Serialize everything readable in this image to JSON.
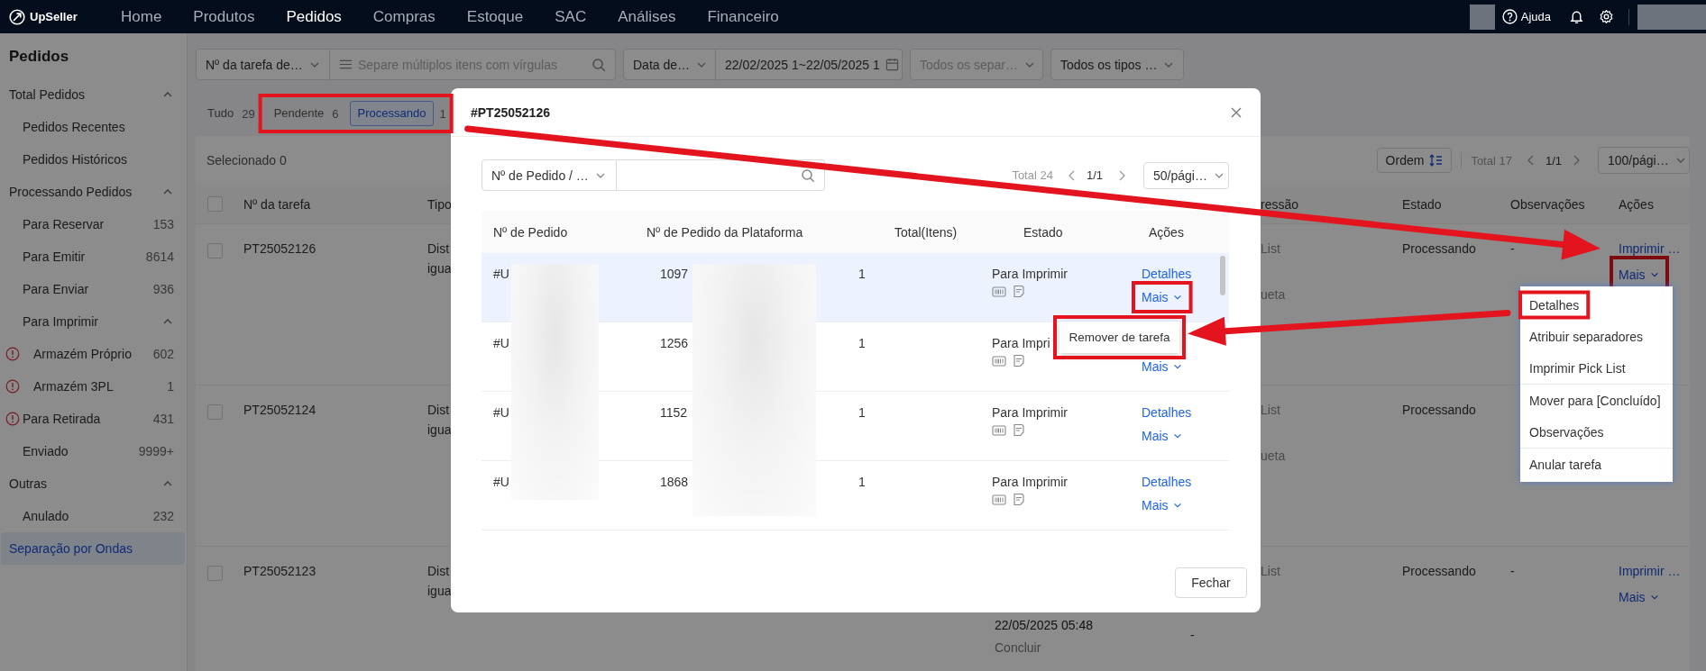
{
  "top_nav": {
    "logo": "UpSeller",
    "items": [
      {
        "label": "Home",
        "selected": false
      },
      {
        "label": "Produtos",
        "selected": false
      },
      {
        "label": "Pedidos",
        "selected": true
      },
      {
        "label": "Compras",
        "selected": false
      },
      {
        "label": "Estoque",
        "selected": false
      },
      {
        "label": "SAC",
        "selected": false
      },
      {
        "label": "Análises",
        "selected": false
      },
      {
        "label": "Financeiro",
        "selected": false
      }
    ],
    "help": "Ajuda"
  },
  "sidebar": {
    "title": "Pedidos",
    "items": [
      {
        "label": "Total Pedidos",
        "expanded": true,
        "selected": false,
        "warning": false,
        "children": [
          {
            "label": "Pedidos Recentes",
            "selected": false,
            "warning": false
          },
          {
            "label": "Pedidos Históricos",
            "selected": false,
            "warning": false
          }
        ]
      },
      {
        "label": "Processando Pedidos",
        "expanded": true,
        "selected": false,
        "warning": false,
        "children": [
          {
            "label": "Para Reservar",
            "count": "153",
            "selected": false,
            "warning": false
          },
          {
            "label": "Para Emitir",
            "count": "8614",
            "selected": false,
            "warning": false
          },
          {
            "label": "Para Enviar",
            "count": "936",
            "selected": false,
            "warning": false
          },
          {
            "label": "Para Imprimir",
            "expanded": true,
            "selected": false,
            "warning": false,
            "children": [
              {
                "label": "Armazém Próprio",
                "count": "602",
                "selected": false,
                "warning": true
              },
              {
                "label": "Armazém 3PL",
                "count": "1",
                "selected": false,
                "warning": true
              }
            ]
          },
          {
            "label": "Para Retirada",
            "count": "431",
            "selected": false,
            "warning": true
          },
          {
            "label": "Enviado",
            "count": "9999+",
            "selected": false,
            "warning": false
          }
        ]
      },
      {
        "label": "Outras",
        "expanded": true,
        "selected": false,
        "warning": false,
        "children": [
          {
            "label": "Anulado",
            "count": "232",
            "selected": false,
            "warning": false
          }
        ]
      },
      {
        "label": "Separação por Ondas",
        "selected": true,
        "warning": false
      }
    ]
  },
  "filters": [
    {
      "kind": "select",
      "value": "Nº da tarefa de…",
      "attached": true
    },
    {
      "kind": "search",
      "placeholder": "Separe múltiplos itens com vírgulas",
      "attached": false
    },
    {
      "kind": "select",
      "value": "Data de…",
      "attached": true
    },
    {
      "kind": "date",
      "value": "22/02/2025 1~22/05/2025 1",
      "attached": false
    },
    {
      "kind": "select",
      "placeholder": "Todos os separ…",
      "attached": false
    },
    {
      "kind": "select",
      "value": "Todos os tipos …",
      "attached": false
    }
  ],
  "status_tabs": [
    {
      "label": "Tudo",
      "count": "29",
      "selected": false,
      "highlighted": false
    },
    {
      "label": "Pendente",
      "count": "6",
      "selected": false,
      "highlighted": true
    },
    {
      "label": "Processando",
      "count": "1",
      "selected": true,
      "highlighted": true
    }
  ],
  "task_table": {
    "toolbar": {
      "selection": "Selecionado 0",
      "sort_button": "Ordem",
      "total": "Total 17",
      "page": "1/1",
      "page_size": "100/pági…"
    },
    "header_checked": false,
    "columns": [
      "Nº da tarefa",
      "Tipo",
      "ressão",
      "Estado",
      "Observações",
      "Ações"
    ],
    "rows": [
      {
        "checked": false,
        "task": "PT25052126",
        "type_lines": [
          "Dist",
          "igua"
        ],
        "print_lines": [
          "List",
          "ueta"
        ],
        "status": "Processando",
        "notes": "-",
        "actions": [
          {
            "kind": "link",
            "label": "Imprimir …",
            "highlighted": false
          },
          {
            "kind": "menu",
            "label": "Mais",
            "highlighted": true
          }
        ]
      },
      {
        "checked": false,
        "task": "PT25052124",
        "type_lines": [
          "Dist",
          "igua"
        ],
        "print_lines": [
          "List",
          "ueta"
        ],
        "status": "Processando"
      },
      {
        "checked": false,
        "task": "PT25052123",
        "type_lines": [
          "Dist",
          "igua"
        ],
        "schedule_lines": [
          "22/05/2025 05:48",
          "Concluir"
        ],
        "print_extra": "-",
        "print_lines": [
          "List"
        ],
        "status": "Processando",
        "notes": "-",
        "actions": [
          {
            "kind": "link",
            "label": "Imprimir …",
            "highlighted": false
          },
          {
            "kind": "menu",
            "label": "Mais",
            "highlighted": false
          }
        ]
      }
    ]
  },
  "modal": {
    "title": "#PT25052126",
    "filter_select": "Nº de Pedido / …",
    "total": "Total 24",
    "page": "1/1",
    "page_size": "50/pági…",
    "columns": [
      "Nº de Pedido",
      "Nº de Pedido da Plataforma",
      "Total(Itens)",
      "Estado",
      "Ações"
    ],
    "rows": [
      {
        "order": "#U",
        "platform": "1097",
        "total": "1",
        "status": "Para Imprimir",
        "hover": true,
        "actions": [
          {
            "kind": "link",
            "label": "Detalhes",
            "highlighted": false
          },
          {
            "kind": "menu",
            "label": "Mais",
            "highlighted": true
          }
        ]
      },
      {
        "order": "#U",
        "platform": "1256",
        "total": "1",
        "status": "Para Impri",
        "hover": false,
        "actions": [
          {
            "kind": "menu",
            "label": "Mais",
            "highlighted": false
          }
        ]
      },
      {
        "order": "#U",
        "platform": "1152",
        "total": "1",
        "status": "Para Imprimir",
        "hover": false,
        "actions": [
          {
            "kind": "link",
            "label": "Detalhes",
            "highlighted": false
          },
          {
            "kind": "menu",
            "label": "Mais",
            "highlighted": false
          }
        ]
      },
      {
        "order": "#U",
        "platform": "1868",
        "total": "1",
        "status": "Para Imprimir",
        "hover": false,
        "actions": [
          {
            "kind": "link",
            "label": "Detalhes",
            "highlighted": false
          },
          {
            "kind": "menu",
            "label": "Mais",
            "highlighted": false
          }
        ]
      }
    ],
    "close_button": "Fechar"
  },
  "row_menu": {
    "items": [
      {
        "label": "Remover de tarefa",
        "highlighted": true
      }
    ]
  },
  "task_menu": {
    "items": [
      {
        "label": "Detalhes",
        "highlighted": true,
        "divider_before": false
      },
      {
        "label": "Atribuir separadores",
        "highlighted": false,
        "divider_before": false
      },
      {
        "label": "Imprimir Pick List",
        "highlighted": false,
        "divider_before": false
      },
      {
        "label": "Mover para [Concluído]",
        "highlighted": false,
        "divider_before": true
      },
      {
        "label": "Observações",
        "highlighted": false,
        "divider_before": false
      },
      {
        "label": "Anular tarefa",
        "highlighted": false,
        "divider_before": true
      }
    ]
  }
}
